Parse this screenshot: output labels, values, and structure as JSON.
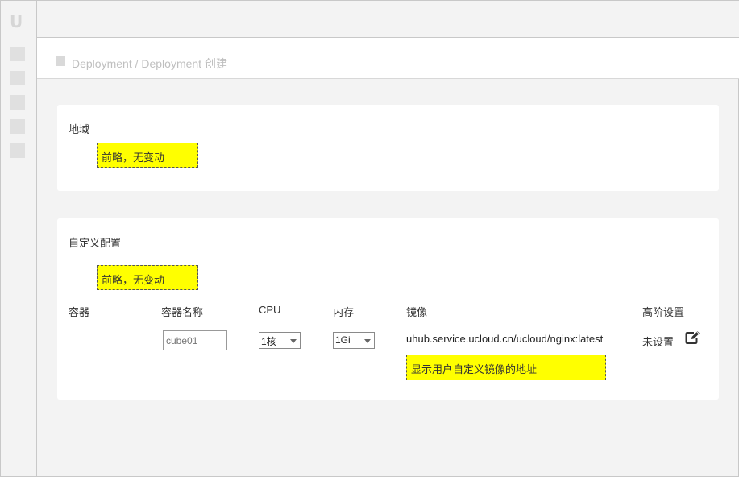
{
  "app": {
    "logo_text": "U"
  },
  "breadcrumb": {
    "text": "Deployment / Deployment 创建"
  },
  "region_section": {
    "title": "地域",
    "note": "前略，无变动"
  },
  "custom_section": {
    "title": "自定义配置",
    "note": "前略，无变动",
    "columns": {
      "container": "容器",
      "container_name": "容器名称",
      "cpu": "CPU",
      "memory": "内存",
      "image": "镜像",
      "advanced": "高阶设置"
    },
    "row": {
      "name_placeholder": "cube01",
      "cpu_value": "1核",
      "memory_value": "1Gi",
      "image_url": "uhub.service.ucloud.cn/ucloud/nginx:latest",
      "advanced_value": "未设置"
    },
    "image_note": "显示用户自定义镜像的地址"
  },
  "icons": {
    "edit": "edit-icon",
    "breadcrumb": "square-icon",
    "nav": [
      "nav-item-icon",
      "nav-item-icon",
      "nav-item-icon",
      "nav-item-icon",
      "nav-item-icon"
    ]
  },
  "colors": {
    "annotation_highlight": "#ffff00",
    "page_bg": "#f3f3f3",
    "card_bg": "#ffffff"
  }
}
